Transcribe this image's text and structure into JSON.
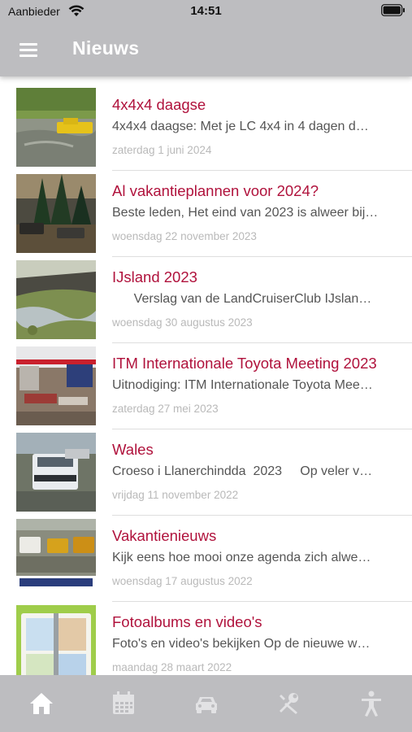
{
  "status_bar": {
    "carrier": "Aanbieder",
    "time": "14:51",
    "icons": [
      "wifi-icon",
      "battery-icon"
    ]
  },
  "header": {
    "title": "Nieuws",
    "menu_icon": "hamburger-menu-icon",
    "background": "#bdbdc0"
  },
  "colors": {
    "title_accent": "#b0123c",
    "excerpt": "#555555",
    "date": "#b9b9b9"
  },
  "news": [
    {
      "title": "4x4x4 daagse",
      "excerpt": "4x4x4 daagse: Met je LC 4x4 in 4 dagen d…",
      "date": "zaterdag 1 juni 2024",
      "thumb": "yellow-truck-wading-photo"
    },
    {
      "title": "Al vakantieplannen voor 2024?",
      "excerpt": "Beste leden, Het eind van 2023 is alweer bij…",
      "date": "woensdag 22 november 2023",
      "thumb": "trucks-in-forest-photo"
    },
    {
      "title": "IJsland 2023",
      "excerpt": "      Verslag van de LandCruiserClub IJslan…",
      "date": "woensdag 30 augustus 2023",
      "thumb": "iceland-river-landscape-photo"
    },
    {
      "title": "ITM Internationale Toyota Meeting 2023",
      "excerpt": "Uitnodiging: ITM Internationale Toyota Mee…",
      "date": "zaterdag 27 mei 2023",
      "thumb": "toyota-meeting-tents-photo"
    },
    {
      "title": "Wales",
      "excerpt": "Croeso i Llanerchindda  2023     Op veler v…",
      "date": "vrijdag 11 november 2022",
      "thumb": "white-pickup-mud-photo"
    },
    {
      "title": "Vakantienieuws",
      "excerpt": "Kijk eens hoe mooi onze agenda zich alwe…",
      "date": "woensdag 17 augustus 2022",
      "thumb": "landcruiser-club-vehicles-photo"
    },
    {
      "title": "Fotoalbums en video's",
      "excerpt": "Foto's en video's bekijken Op de nieuwe w…",
      "date": "maandag 28 maart 2022",
      "thumb": "photo-album-illustration"
    }
  ],
  "tabbar": {
    "tabs": [
      {
        "icon": "home-icon",
        "active": true
      },
      {
        "icon": "calendar-icon",
        "active": false
      },
      {
        "icon": "car-icon",
        "active": false
      },
      {
        "icon": "tools-icon",
        "active": false
      },
      {
        "icon": "accessibility-person-icon",
        "active": false
      }
    ]
  }
}
